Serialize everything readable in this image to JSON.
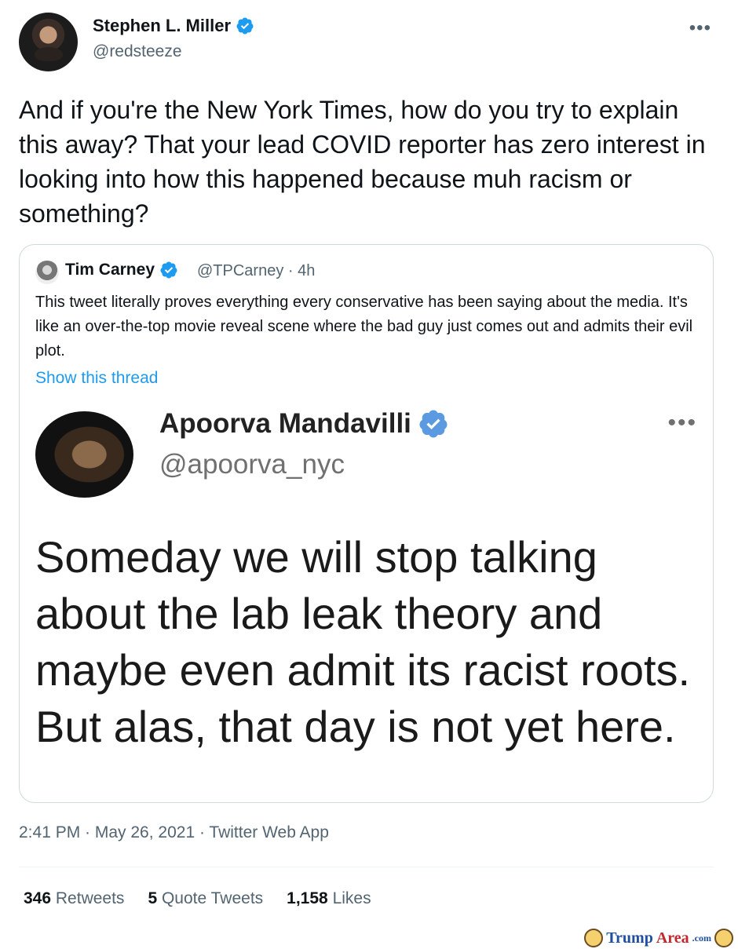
{
  "tweet": {
    "author_name": "Stephen L. Miller",
    "author_handle": "@redsteeze",
    "more_icon": "more-horizontal-icon",
    "text": "And if you're the New York Times, how do you try to explain this away? That your lead COVID reporter has zero interest in looking into how this happened because muh racism or something?",
    "timestamp": "2:41 PM · May 26, 2021 · Twitter Web App"
  },
  "quote": {
    "author_name": "Tim Carney",
    "author_meta": "@TPCarney · 4h",
    "text": "This tweet literally proves everything every conservative has been saying about the media. It's like an over-the-top movie reveal scene where the bad guy just comes out and admits their evil plot.",
    "show_thread": "Show this thread",
    "embedded": {
      "author_name": "Apoorva Mandavilli",
      "author_handle": "@apoorva_nyc",
      "text": "Someday we will stop talking about the lab leak theory and maybe even admit its racist roots. But alas, that day is not yet here."
    }
  },
  "stats": {
    "retweets_count": "346",
    "retweets_label": "Retweets",
    "quotes_count": "5",
    "quotes_label": "Quote Tweets",
    "likes_count": "1,158",
    "likes_label": "Likes"
  },
  "watermark": {
    "part1": "Trump",
    "part2": "Area",
    "part3": ".com"
  },
  "colors": {
    "accent": "#1d9bf0",
    "secondary_text": "#536471",
    "border": "#cfd9de"
  }
}
